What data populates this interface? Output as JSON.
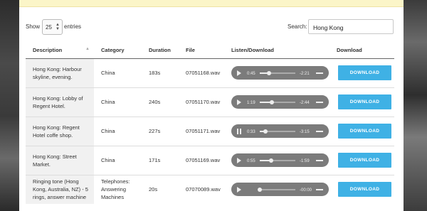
{
  "controls": {
    "show_label": "Show",
    "length_value": "25",
    "entries_label": "entries",
    "search_label": "Search:",
    "search_value": "Hong Kong"
  },
  "table": {
    "headers": [
      "Description",
      "Category",
      "Duration",
      "File",
      "Listen/Download",
      "Download"
    ],
    "rows": [
      {
        "description": "Hong Kong: Harbour skyline, evening.",
        "category": "China",
        "duration": "183s",
        "file": "07051168.wav",
        "player": {
          "state": "play",
          "current": "0:45",
          "remaining": "-2:21",
          "progress": 0.25
        },
        "button": "DOWNLOAD"
      },
      {
        "description": "Hong Kong: Lobby of Regent Hotel.",
        "category": "China",
        "duration": "240s",
        "file": "07051170.wav",
        "player": {
          "state": "play",
          "current": "1:19",
          "remaining": "-2:44",
          "progress": 0.33
        },
        "button": "DOWNLOAD"
      },
      {
        "description": "Hong Kong: Regent Hotel coffe shop.",
        "category": "China",
        "duration": "227s",
        "file": "07051171.wav",
        "player": {
          "state": "pause",
          "current": "0:33",
          "remaining": "-3:15",
          "progress": 0.15
        },
        "button": "DOWNLOAD"
      },
      {
        "description": "Hong Kong: Street Market.",
        "category": "China",
        "duration": "171s",
        "file": "07051169.wav",
        "player": {
          "state": "play",
          "current": "0:55",
          "remaining": "-1:59",
          "progress": 0.32
        },
        "button": "DOWNLOAD"
      },
      {
        "description": "Ringing tone (Hong Kong, Australia, NZ) - 5 rings, answer machine",
        "category": "Telephones: Answering Machines",
        "duration": "20s",
        "file": "07070089.wav",
        "player": {
          "state": "play",
          "current": "",
          "remaining": "-00:00",
          "progress": 0.0
        },
        "button": "DOWNLOAD"
      }
    ]
  },
  "colors": {
    "accent": "#3fb1e5",
    "notice_bg": "#fbf5c8",
    "player_bg": "#7b7b7b"
  }
}
